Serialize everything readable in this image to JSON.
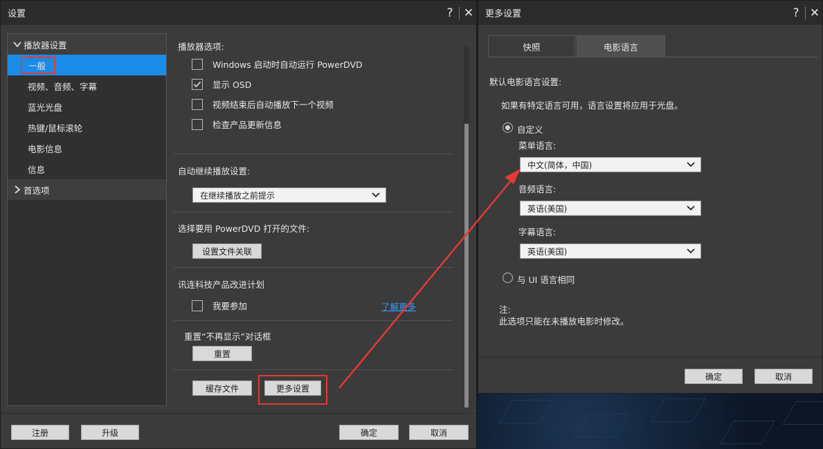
{
  "settings_dialog": {
    "title": "设置",
    "help_glyph": "?",
    "close_glyph": "✕",
    "nav": {
      "group1": "播放器设置",
      "items": [
        "一般",
        "视频、音频、字幕",
        "蓝光光盘",
        "热键/鼠标滚轮",
        "电影信息",
        "信息"
      ],
      "group2": "首选项"
    },
    "player_options_label": "播放器选项:",
    "checkboxes": [
      {
        "label": "Windows 启动时自动运行 PowerDVD",
        "checked": false
      },
      {
        "label": "显示 OSD",
        "checked": true
      },
      {
        "label": "视频结束后自动播放下一个视频",
        "checked": false
      },
      {
        "label": "检查产品更新信息",
        "checked": false
      }
    ],
    "resume_label": "自动继续播放设置:",
    "resume_select": "在继续播放之前提示",
    "file_assoc_label": "选择要用 PowerDVD 打开的文件:",
    "file_assoc_button": "设置文件关联",
    "program_label": "讯连科技产品改进计划",
    "join_label": "我要参加",
    "learn_more": "了解更多",
    "reset_label": "重置“不再显示”对话框",
    "reset_button": "重置",
    "cache_button": "缓存文件",
    "more_button": "更多设置",
    "register_button": "注册",
    "upgrade_button": "升级",
    "ok_button": "确定",
    "cancel_button": "取消"
  },
  "more_dialog": {
    "title": "更多设置",
    "help_glyph": "?",
    "close_glyph": "✕",
    "tabs": [
      "快照",
      "电影语言"
    ],
    "active_tab": "电影语言",
    "default_label": "默认电影语言设置:",
    "hint": "如果有特定语言可用，语言设置将应用于光盘。",
    "custom_radio": "自定义",
    "menu_lang_label": "菜单语言:",
    "menu_lang_value": "中文(简体，中国)",
    "audio_lang_label": "音频语言:",
    "audio_lang_value": "英语(美国)",
    "subtitle_lang_label": "字幕语言:",
    "subtitle_lang_value": "英语(美国)",
    "same_ui_radio": "与 UI 语言相同",
    "note_title": "注:",
    "note_text": "此选项只能在未播放电影时修改。",
    "ok_button": "确定",
    "cancel_button": "取消"
  },
  "colors": {
    "highlight": "#1a8be6",
    "annotation_red": "#e53935",
    "link": "#2f9bff"
  }
}
